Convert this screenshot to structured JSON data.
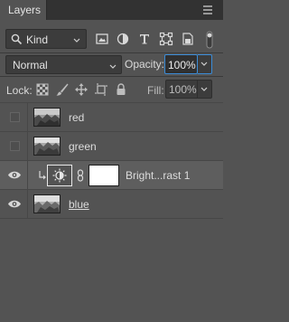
{
  "panel": {
    "title": "Layers"
  },
  "filter": {
    "kind_label": "Kind",
    "icons": [
      "image-filter-icon",
      "adjustment-filter-icon",
      "type-filter-icon",
      "shape-filter-icon",
      "smart-object-filter-icon"
    ]
  },
  "blending": {
    "mode": "Normal",
    "opacity_label": "Opacity:",
    "opacity_value": "100%"
  },
  "lock": {
    "label": "Lock:",
    "icons": [
      "lock-transparent-pixels-icon",
      "lock-image-pixels-icon",
      "lock-position-icon",
      "lock-artboard-icon",
      "lock-all-icon"
    ],
    "fill_label": "Fill:",
    "fill_value": "100%"
  },
  "layers": [
    {
      "name": "red",
      "visible": false
    },
    {
      "name": "green",
      "visible": false
    },
    {
      "name": "Bright...rast 1",
      "visible": true,
      "type": "adjustment",
      "clipped": true
    },
    {
      "name": "blue",
      "visible": true
    }
  ],
  "colors": {
    "panel_bg": "#535353",
    "titlebar_bg": "#323232",
    "field_bg": "#3c3c3c",
    "focus_border": "#3b8cd7"
  }
}
